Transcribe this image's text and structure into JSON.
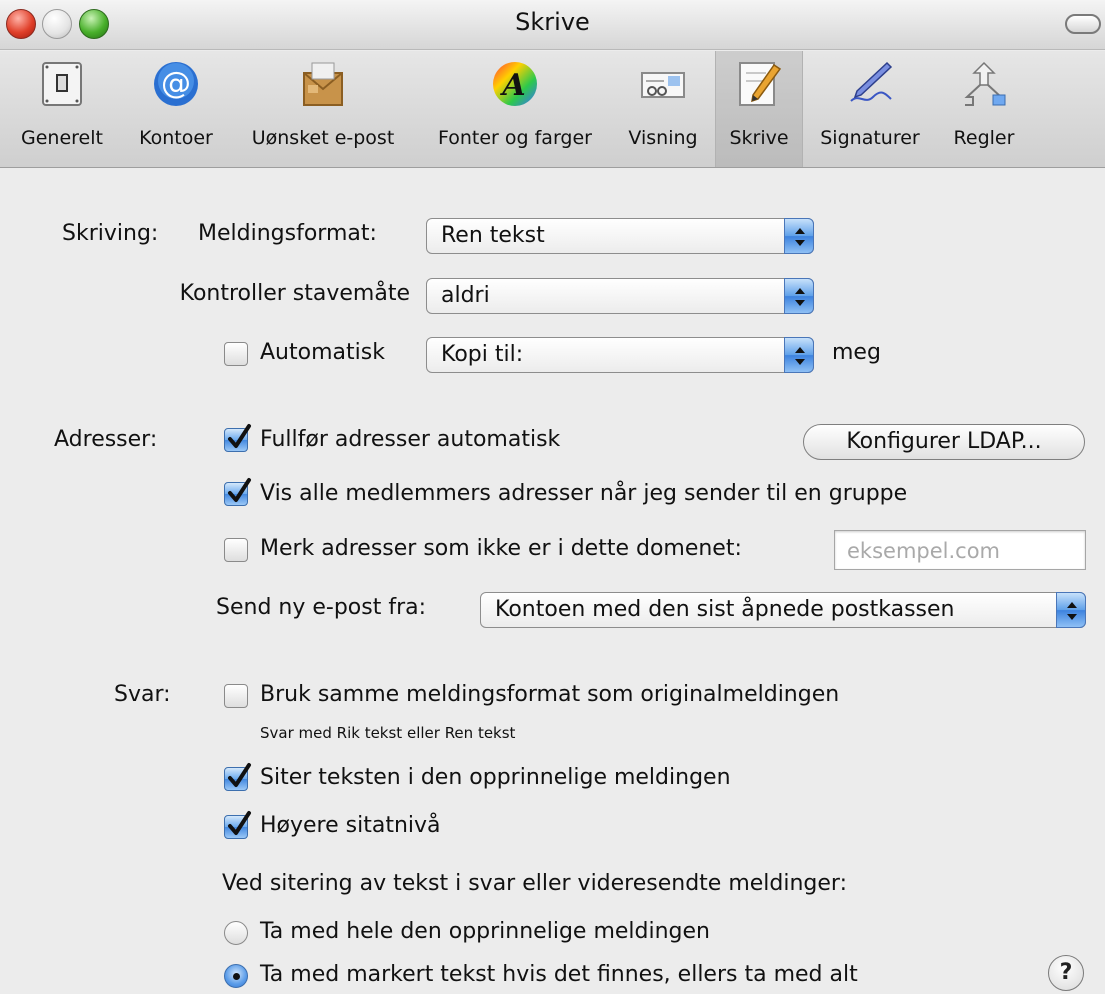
{
  "window": {
    "title": "Skrive"
  },
  "toolbar": {
    "items": [
      {
        "label": "Generelt",
        "icon": "switch-icon"
      },
      {
        "label": "Kontoer",
        "icon": "at-sign-icon"
      },
      {
        "label": "Uønsket e-post",
        "icon": "junk-mail-icon"
      },
      {
        "label": "Fonter og farger",
        "icon": "font-colors-icon"
      },
      {
        "label": "Visning",
        "icon": "viewing-icon"
      },
      {
        "label": "Skrive",
        "icon": "pencil-icon",
        "selected": true
      },
      {
        "label": "Signaturer",
        "icon": "signature-pen-icon"
      },
      {
        "label": "Regler",
        "icon": "rules-icon"
      }
    ]
  },
  "composing": {
    "section_label": "Skriving:",
    "message_format_label": "Meldingsformat:",
    "message_format_value": "Ren tekst",
    "spellcheck_label": "Kontroller stavemåte",
    "spellcheck_value": "aldri",
    "auto_label": "Automatisk",
    "auto_checked": false,
    "auto_value": "Kopi til:",
    "auto_suffix": "meg"
  },
  "addressing": {
    "section_label": "Adresser:",
    "autocomplete_label": "Fullfør adresser automatisk",
    "autocomplete_checked": true,
    "ldap_button": "Konfigurer LDAP...",
    "show_all_label": "Vis alle medlemmers adresser når jeg sender til en gruppe",
    "show_all_checked": true,
    "mark_label": "Merk adresser som ikke er i dette domenet:",
    "mark_checked": false,
    "domain_placeholder": "eksempel.com",
    "send_from_label": "Send ny e-post fra:",
    "send_from_value": "Kontoen med den sist åpnede postkassen"
  },
  "responding": {
    "section_label": "Svar:",
    "same_format_label": "Bruk samme meldingsformat som originalmeldingen",
    "same_format_checked": false,
    "same_format_hint": "Svar med Rik tekst eller Ren tekst",
    "quote_label": "Siter teksten i den opprinnelige meldingen",
    "quote_checked": true,
    "increase_quote_label": "Høyere sitatnivå",
    "increase_quote_checked": true,
    "quoting_heading": "Ved sitering av tekst i svar eller videresendte meldinger:",
    "include_all_label": "Ta med hele den opprinnelige meldingen",
    "include_all_selected": false,
    "include_selected_label": "Ta med markert tekst hvis det finnes, ellers ta med alt",
    "include_selected_selected": true
  },
  "help_button": "?"
}
